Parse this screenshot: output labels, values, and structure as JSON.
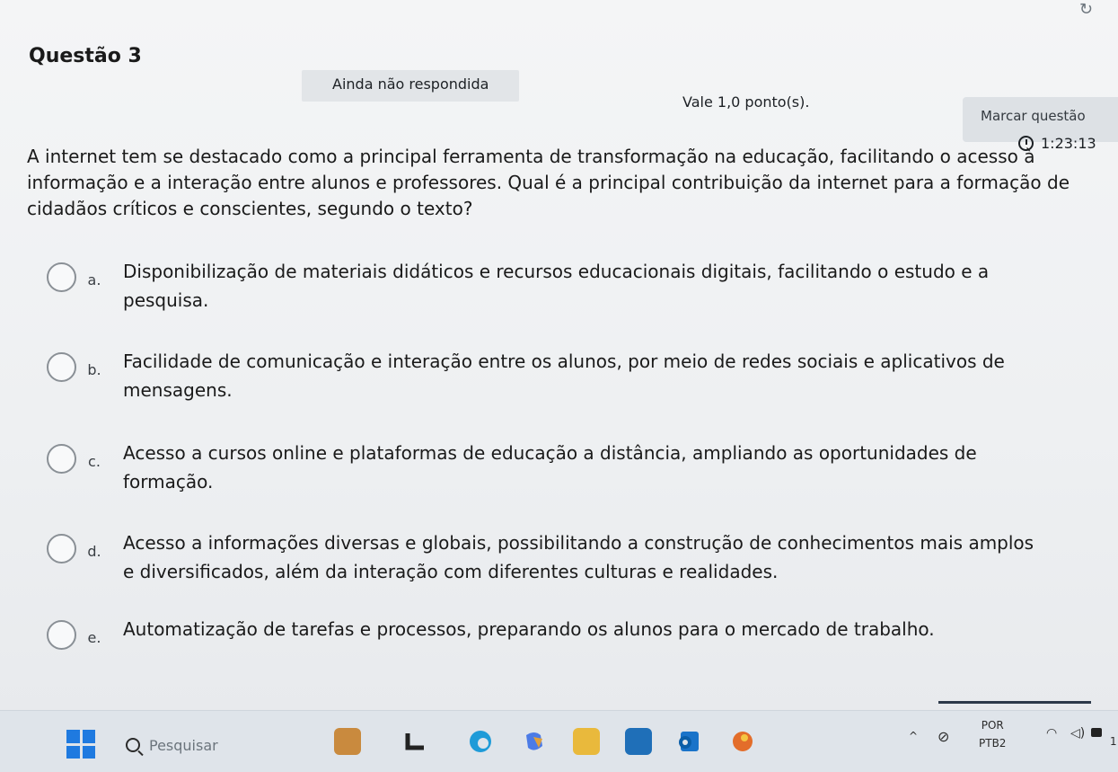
{
  "question": {
    "title": "Questão 3",
    "status": "Ainda não respondida",
    "points": "Vale 1,0 ponto(s).",
    "flag_label": "Marcar questão",
    "timer": "1:23:13",
    "text": "A internet tem se destacado como a principal ferramenta de transformação na educação, facilitando o acesso à informação e a interação entre alunos e professores. Qual é a principal contribuição da internet para a formação de cidadãos críticos e conscientes, segundo o texto?"
  },
  "options": [
    {
      "letter": "a.",
      "text": "Disponibilização de materiais didáticos e recursos educacionais digitais, facilitando o estudo e a pesquisa."
    },
    {
      "letter": "b.",
      "text": "Facilidade de comunicação e interação entre os alunos, por meio de redes sociais e aplicativos de mensagens."
    },
    {
      "letter": "c.",
      "text": "Acesso a cursos online e plataformas de educação a distância, ampliando as oportunidades de formação."
    },
    {
      "letter": "d.",
      "text": "Acesso a informações diversas e globais, possibilitando a construção de conhecimentos mais amplos e diversificados, além da interação com diferentes culturas e realidades."
    },
    {
      "letter": "e.",
      "text": "Automatização de tarefas e processos, preparando os alunos para o mercado de trabalho."
    }
  ],
  "taskbar": {
    "search_placeholder": "Pesquisar",
    "lang_top": "POR",
    "lang_bottom": "PTB2",
    "clock_fragment": "1"
  },
  "colors": {
    "windows_blue": "#1f7ae0",
    "badge_bg": "#e2e5e8"
  }
}
